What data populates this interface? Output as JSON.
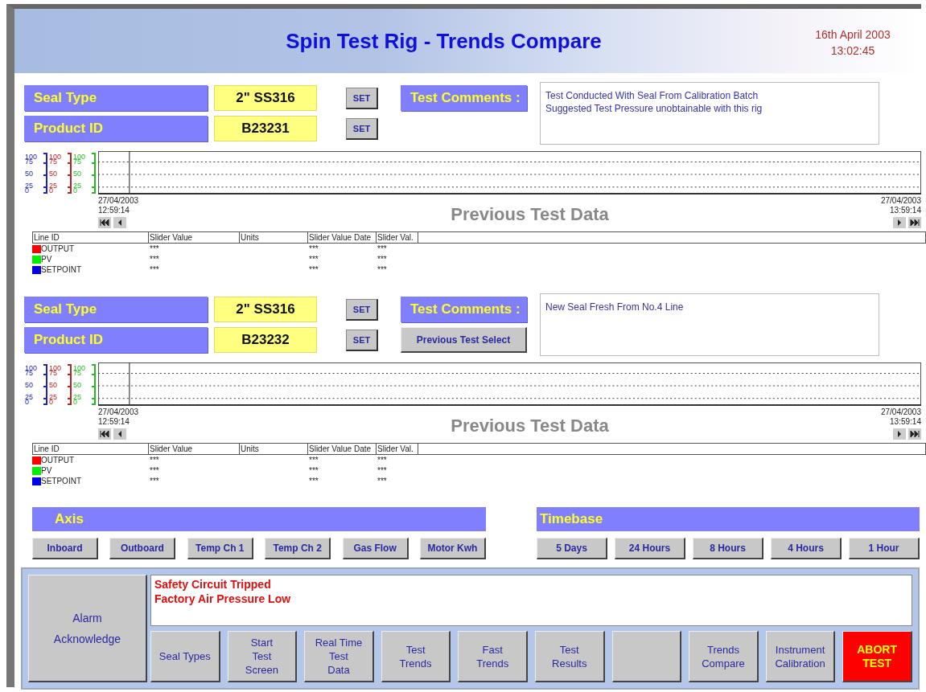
{
  "header": {
    "title": "Spin Test Rig - Trends Compare",
    "date": "16th April 2003",
    "time": "13:02:45"
  },
  "sections": [
    {
      "seal_type": {
        "label": "Seal Type",
        "value": "2\" SS316",
        "button": "SET"
      },
      "product_id": {
        "label": "Product ID",
        "value": "B23231",
        "button": "SET"
      },
      "comments_label": "Test Comments :",
      "comments": [
        "Test Conducted With Seal From Calibration Batch",
        "Suggested Test Pressure unobtainable with this rig"
      ],
      "trend": {
        "scales": [
          {
            "color": "#2222bb",
            "ticks": [
              "100",
              "75",
              "50",
              "25",
              "0"
            ]
          },
          {
            "color": "#bb2222",
            "ticks": [
              "100",
              "75",
              "50",
              "25",
              "0"
            ]
          },
          {
            "color": "#22bb22",
            "ticks": [
              "100",
              "75",
              "50",
              "25",
              "0"
            ]
          }
        ],
        "start_date": "27/04/2003",
        "start_time": "12:59:14",
        "end_date": "27/04/2003",
        "end_time": "13:59:14",
        "caption": "Previous Test Data"
      },
      "legend": {
        "columns": [
          "Line ID",
          "Slider Value",
          "Units",
          "Slider Value Date",
          "Slider Val."
        ],
        "rows": [
          {
            "color": "#ff0000",
            "cells": [
              "OUTPUT",
              "***",
              "",
              "***",
              "***"
            ]
          },
          {
            "color": "#00ee00",
            "cells": [
              "PV",
              "***",
              "",
              "***",
              "***"
            ]
          },
          {
            "color": "#0000ee",
            "cells": [
              "SETPOINT",
              "***",
              "",
              "***",
              "***"
            ]
          }
        ]
      }
    },
    {
      "seal_type": {
        "label": "Seal Type",
        "value": "2\" SS316",
        "button": "SET"
      },
      "product_id": {
        "label": "Product ID",
        "value": "B23232",
        "button": "SET"
      },
      "comments_label": "Test Comments :",
      "select_button": "Previous Test Select",
      "comments": [
        "New Seal Fresh From No.4 Line"
      ],
      "trend": {
        "scales": [
          {
            "color": "#2222bb",
            "ticks": [
              "100",
              "75",
              "50",
              "25",
              "0"
            ]
          },
          {
            "color": "#bb2222",
            "ticks": [
              "100",
              "75",
              "50",
              "25",
              "0"
            ]
          },
          {
            "color": "#22bb22",
            "ticks": [
              "100",
              "75",
              "50",
              "25",
              "0"
            ]
          }
        ],
        "start_date": "27/04/2003",
        "start_time": "12:59:14",
        "end_date": "27/04/2003",
        "end_time": "13:59:14",
        "caption": "Previous Test Data"
      },
      "legend": {
        "columns": [
          "Line ID",
          "Slider Value",
          "Units",
          "Slider Value Date",
          "Slider Val."
        ],
        "rows": [
          {
            "color": "#ff0000",
            "cells": [
              "OUTPUT",
              "***",
              "",
              "***",
              "***"
            ]
          },
          {
            "color": "#00ee00",
            "cells": [
              "PV",
              "***",
              "",
              "***",
              "***"
            ]
          },
          {
            "color": "#0000ee",
            "cells": [
              "SETPOINT",
              "***",
              "",
              "***",
              "***"
            ]
          }
        ]
      }
    }
  ],
  "axis": {
    "title": "Axis",
    "buttons": [
      "Inboard",
      "Outboard",
      "Temp Ch 1",
      "Temp Ch 2",
      "Gas Flow",
      "Motor Kwh"
    ]
  },
  "timebase": {
    "title": "Timebase",
    "buttons": [
      "5 Days",
      "24 Hours",
      "8 Hours",
      "4 Hours",
      "1 Hour"
    ]
  },
  "alarm": {
    "acknowledge": [
      "Alarm",
      "Acknowledge"
    ],
    "messages": [
      "Safety Circuit Tripped",
      "Factory Air Pressure Low"
    ]
  },
  "nav": [
    {
      "kind": "normal",
      "lines": [
        "Seal Types"
      ]
    },
    {
      "kind": "normal",
      "lines": [
        "Start",
        "Test",
        "Screen"
      ]
    },
    {
      "kind": "normal",
      "lines": [
        "Real Time",
        "Test",
        "Data"
      ]
    },
    {
      "kind": "normal",
      "lines": [
        "Test",
        "Trends"
      ]
    },
    {
      "kind": "normal",
      "lines": [
        "Fast",
        "Trends"
      ]
    },
    {
      "kind": "normal",
      "lines": [
        "Test",
        "Results"
      ]
    },
    {
      "kind": "blank"
    },
    {
      "kind": "normal",
      "lines": [
        "Trends",
        "Compare"
      ]
    },
    {
      "kind": "normal",
      "lines": [
        "Instrument",
        "Calibration"
      ]
    },
    {
      "kind": "abort",
      "lines": [
        "ABORT",
        "TEST"
      ]
    }
  ]
}
